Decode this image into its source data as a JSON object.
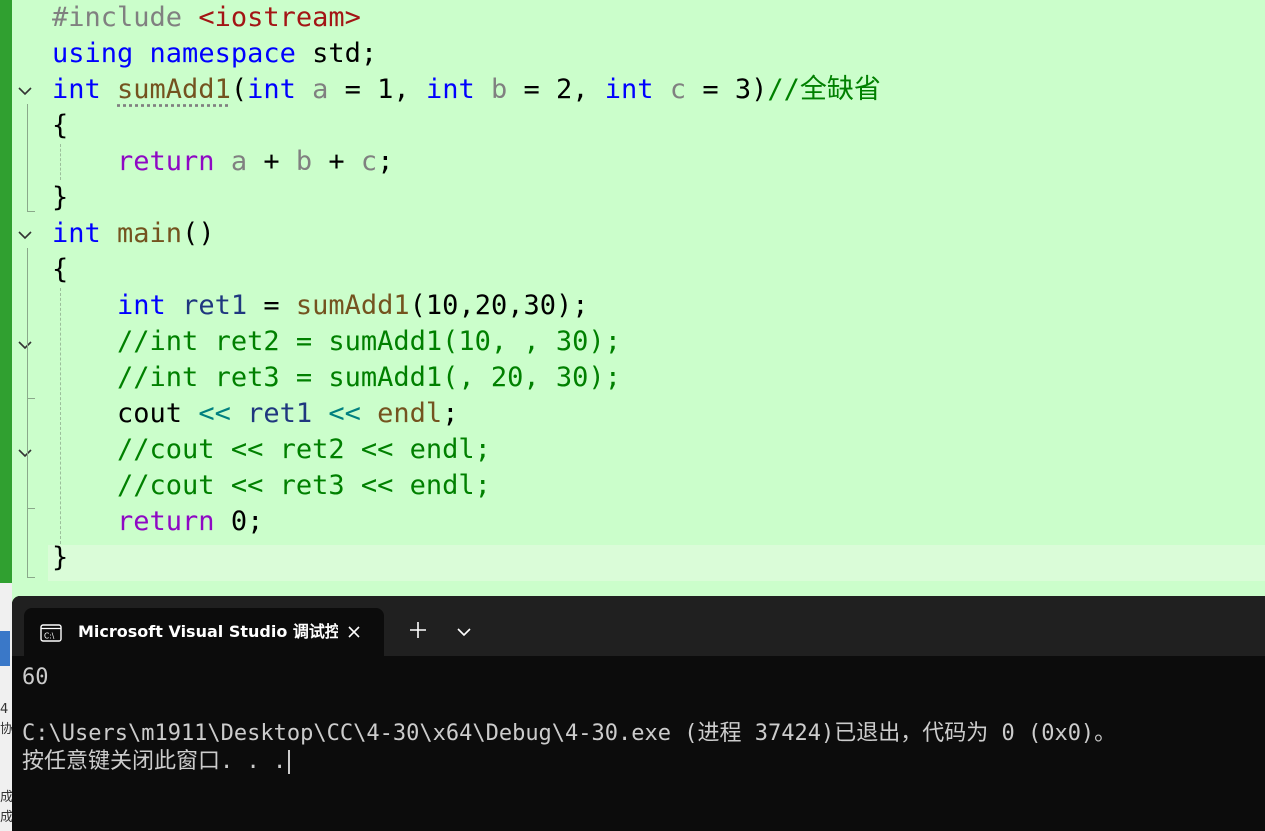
{
  "editor": {
    "lines": [
      {
        "tokens": [
          {
            "t": "#include ",
            "c": "pre"
          },
          {
            "t": "<iostream>",
            "c": "inc"
          }
        ]
      },
      {
        "tokens": [
          {
            "t": "using ",
            "c": "kw"
          },
          {
            "t": "namespace ",
            "c": "kw"
          },
          {
            "t": "std;",
            "c": "black"
          }
        ]
      },
      {
        "tokens": [
          {
            "t": "int ",
            "c": "kw"
          },
          {
            "t": "sumAdd1",
            "c": "fn squiggle"
          },
          {
            "t": "(",
            "c": "black"
          },
          {
            "t": "int ",
            "c": "kw"
          },
          {
            "t": "a",
            "c": "prm"
          },
          {
            "t": " = 1, ",
            "c": "black"
          },
          {
            "t": "int ",
            "c": "kw"
          },
          {
            "t": "b",
            "c": "prm"
          },
          {
            "t": " = 2, ",
            "c": "black"
          },
          {
            "t": "int ",
            "c": "kw"
          },
          {
            "t": "c",
            "c": "prm"
          },
          {
            "t": " = 3)",
            "c": "black"
          },
          {
            "t": "//全缺省",
            "c": "cm"
          }
        ]
      },
      {
        "tokens": [
          {
            "t": "{",
            "c": "black"
          }
        ]
      },
      {
        "tokens": [
          {
            "t": "    ",
            "c": "black"
          },
          {
            "t": "return ",
            "c": "ret"
          },
          {
            "t": "a",
            "c": "prm"
          },
          {
            "t": " + ",
            "c": "black"
          },
          {
            "t": "b",
            "c": "prm"
          },
          {
            "t": " + ",
            "c": "black"
          },
          {
            "t": "c",
            "c": "prm"
          },
          {
            "t": ";",
            "c": "black"
          }
        ]
      },
      {
        "tokens": [
          {
            "t": "}",
            "c": "black"
          }
        ]
      },
      {
        "tokens": [
          {
            "t": "int ",
            "c": "kw"
          },
          {
            "t": "main",
            "c": "fn"
          },
          {
            "t": "()",
            "c": "black"
          }
        ]
      },
      {
        "tokens": [
          {
            "t": "{",
            "c": "black"
          }
        ]
      },
      {
        "tokens": [
          {
            "t": "    ",
            "c": "black"
          },
          {
            "t": "int ",
            "c": "kw"
          },
          {
            "t": "ret1",
            "c": "var"
          },
          {
            "t": " = ",
            "c": "black"
          },
          {
            "t": "sumAdd1",
            "c": "fn"
          },
          {
            "t": "(10,20,30);",
            "c": "black"
          }
        ]
      },
      {
        "tokens": [
          {
            "t": "    ",
            "c": "black"
          },
          {
            "t": "//int ret2 = sumAdd1(10, , 30);",
            "c": "cm"
          }
        ]
      },
      {
        "tokens": [
          {
            "t": "    ",
            "c": "black"
          },
          {
            "t": "//int ret3 = sumAdd1(, 20, 30);",
            "c": "cm"
          }
        ]
      },
      {
        "tokens": [
          {
            "t": "    ",
            "c": "black"
          },
          {
            "t": "cout ",
            "c": "black"
          },
          {
            "t": "<< ",
            "c": "op"
          },
          {
            "t": "ret1 ",
            "c": "var"
          },
          {
            "t": "<< ",
            "c": "op"
          },
          {
            "t": "endl",
            "c": "fn"
          },
          {
            "t": ";",
            "c": "black"
          }
        ]
      },
      {
        "tokens": [
          {
            "t": "    ",
            "c": "black"
          },
          {
            "t": "//cout << ret2 << endl;",
            "c": "cm"
          }
        ]
      },
      {
        "tokens": [
          {
            "t": "    ",
            "c": "black"
          },
          {
            "t": "//cout << ret3 << endl;",
            "c": "cm"
          }
        ]
      },
      {
        "tokens": [
          {
            "t": "    ",
            "c": "black"
          },
          {
            "t": "return ",
            "c": "ret"
          },
          {
            "t": "0;",
            "c": "black"
          }
        ]
      },
      {
        "tokens": [
          {
            "t": "}",
            "c": "black"
          }
        ]
      }
    ]
  },
  "terminal": {
    "tab_title": "Microsoft Visual Studio 调试控",
    "tab_icon": "console-icon",
    "close_icon": "close-icon",
    "new_tab_icon": "plus-icon",
    "dropdown_icon": "chevron-down-icon",
    "output_lines": [
      "60",
      "",
      "C:\\Users\\m1911\\Desktop\\CC\\4-30\\x64\\Debug\\4-30.exe (进程 37424)已退出，代码为 0 (0x0)。",
      "按任意键关闭此窗口. . ."
    ]
  },
  "background_window": {
    "fragments": [
      "4",
      "协",
      "成",
      "成"
    ]
  }
}
